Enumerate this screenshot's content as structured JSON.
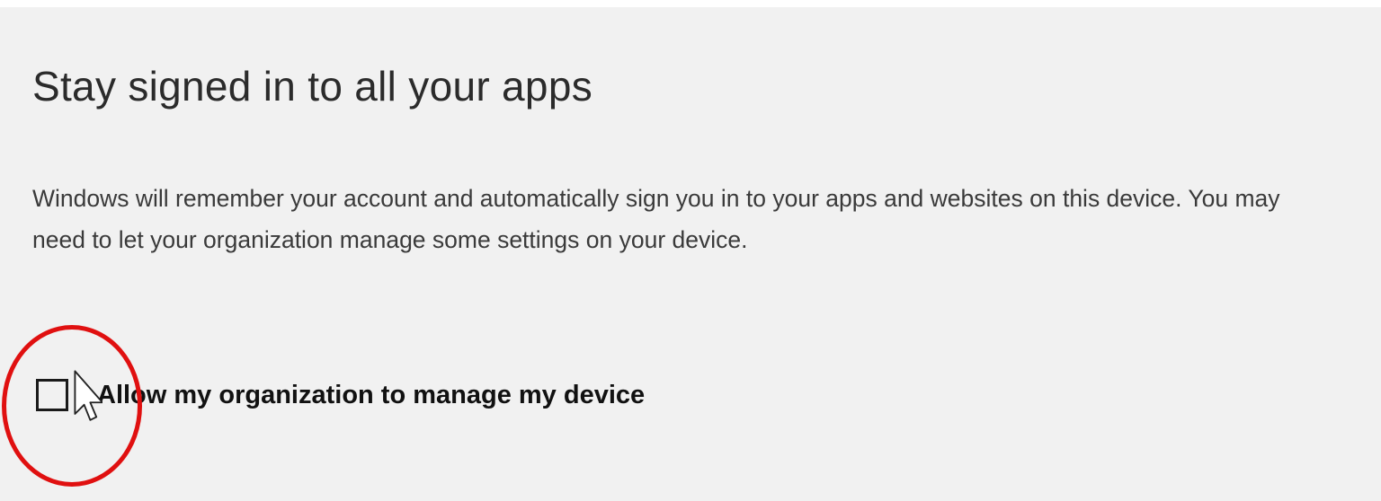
{
  "dialog": {
    "title": "Stay signed in to all your apps",
    "description": "Windows will remember your account and automatically sign you in to your apps and websites on this device. You may need to let your organization manage some settings on your device.",
    "checkbox": {
      "label": "Allow my organization to manage my device",
      "checked": false
    }
  },
  "annotation": {
    "highlight_color": "#e01010"
  },
  "icons": {
    "cursor": "mouse-pointer-icon"
  }
}
